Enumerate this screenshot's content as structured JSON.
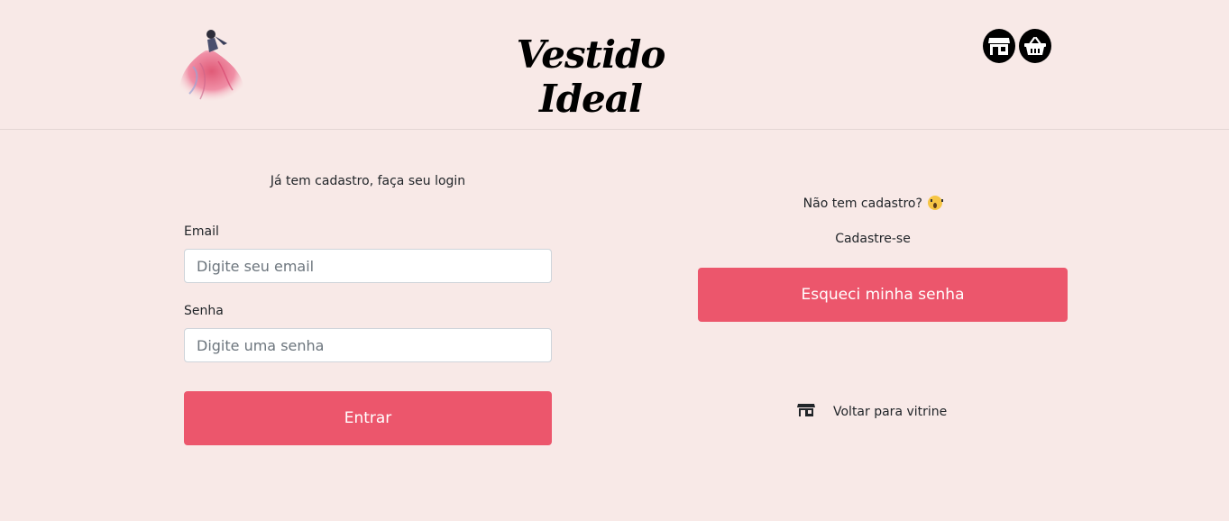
{
  "header": {
    "brand": "Vestido Ideal",
    "logo_icon": "dress-logo-icon",
    "store_icon": "store-icon",
    "cart_icon": "basket-icon"
  },
  "login": {
    "title": "Já tem cadastro, faça seu login",
    "email_label": "Email",
    "email_placeholder": "Digite seu email",
    "email_value": "",
    "senha_label": "Senha",
    "senha_placeholder": "Digite uma senha",
    "senha_value": "",
    "submit_label": "Entrar"
  },
  "register": {
    "question": "Não tem cadastro?",
    "question_emoji": "scream-emoji-icon",
    "link_label": "Cadastre-se",
    "forgot_label": "Esqueci minha senha",
    "back_label": "Voltar para vitrine",
    "back_icon": "store-icon"
  },
  "colors": {
    "background": "#f8e9e7",
    "accent": "#ec566c",
    "icon": "#000000"
  }
}
